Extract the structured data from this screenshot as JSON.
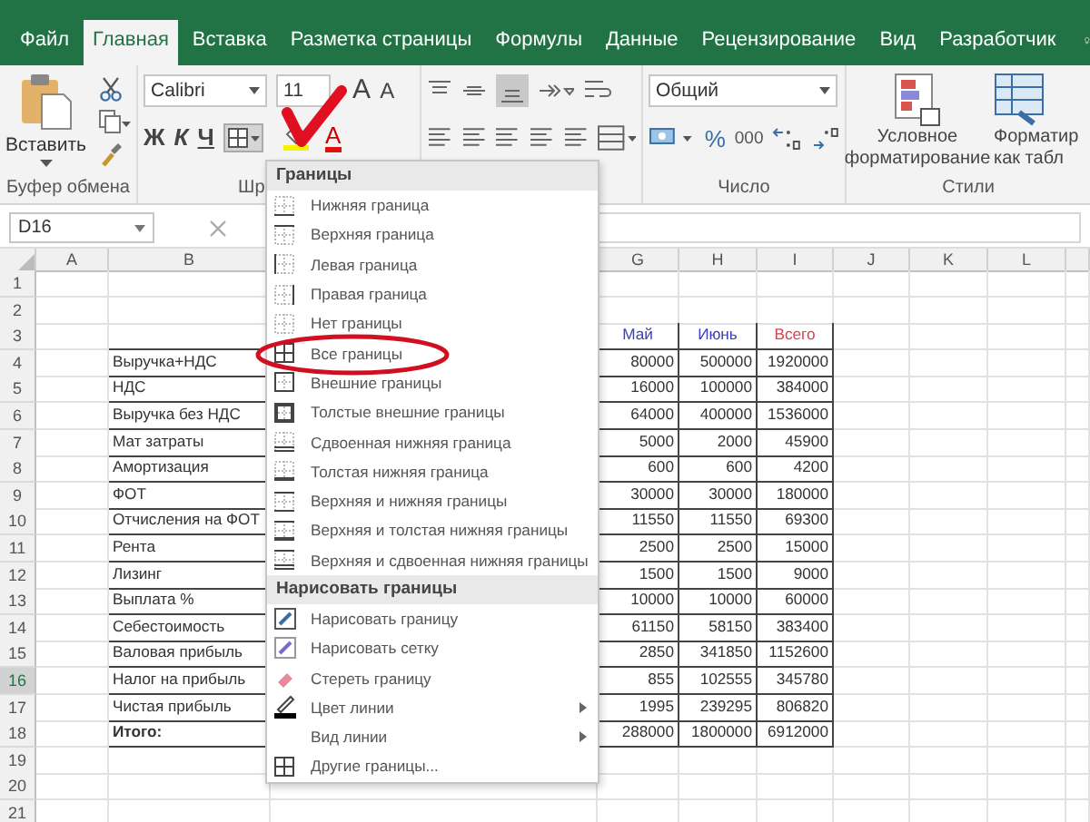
{
  "tabs": [
    {
      "label": "Файл",
      "selected": false
    },
    {
      "label": "Главная",
      "selected": true
    },
    {
      "label": "Вставка",
      "selected": false
    },
    {
      "label": "Разметка страницы",
      "selected": false
    },
    {
      "label": "Формулы",
      "selected": false
    },
    {
      "label": "Данные",
      "selected": false
    },
    {
      "label": "Рецензирование",
      "selected": false
    },
    {
      "label": "Вид",
      "selected": false
    },
    {
      "label": "Разработчик",
      "selected": false
    }
  ],
  "ribbon": {
    "clipboard": {
      "paste_label": "Вставить",
      "group_label": "Буфер обмена"
    },
    "font": {
      "font_name": "Calibri",
      "font_size": "11",
      "grow_key": "A",
      "shrink_key": "A",
      "bold_key": "Ж",
      "italic_key": "К",
      "underline_key": "Ч",
      "font_color_key": "A",
      "group_label": "Шр"
    },
    "number": {
      "format": "Общий",
      "percent": "%",
      "thousands": "000",
      "group_label": "Число"
    },
    "styles": {
      "conditional": "Условное форматирование",
      "format_table": [
        "Форматир",
        "как табл"
      ],
      "group_label": "Стили"
    }
  },
  "formula_bar": {
    "name_box": "D16"
  },
  "sheet": {
    "columns": [
      "A",
      "B",
      "G",
      "H",
      "I",
      "J",
      "K",
      "L"
    ],
    "rows": [
      {
        "num": "1",
        "selected": false
      },
      {
        "num": "2",
        "selected": false
      },
      {
        "num": "3",
        "selected": false,
        "headers": [
          {
            "text": "Май",
            "color": "#3b3bc4"
          },
          {
            "text": "Июнь",
            "color": "#3b3bc4"
          },
          {
            "text": "Всего",
            "color": "#e0404a"
          }
        ]
      },
      {
        "num": "4",
        "selected": false,
        "label": "Выручка+НДС",
        "values": [
          "80000",
          "500000",
          "1920000"
        ]
      },
      {
        "num": "5",
        "selected": false,
        "label": "НДС",
        "values": [
          "16000",
          "100000",
          "384000"
        ]
      },
      {
        "num": "6",
        "selected": false,
        "label": "Выручка без НДС",
        "values": [
          "64000",
          "400000",
          "1536000"
        ]
      },
      {
        "num": "7",
        "selected": false,
        "label": "Мат затраты",
        "values": [
          "5000",
          "2000",
          "45900"
        ]
      },
      {
        "num": "8",
        "selected": false,
        "label": "Амортизация",
        "values": [
          "600",
          "600",
          "4200"
        ]
      },
      {
        "num": "9",
        "selected": false,
        "label": "ФОТ",
        "values": [
          "30000",
          "30000",
          "180000"
        ]
      },
      {
        "num": "10",
        "selected": false,
        "label": "Отчисления на ФОТ",
        "values": [
          "11550",
          "11550",
          "69300"
        ]
      },
      {
        "num": "11",
        "selected": false,
        "label": "Рента",
        "values": [
          "2500",
          "2500",
          "15000"
        ]
      },
      {
        "num": "12",
        "selected": false,
        "label": "Лизинг",
        "values": [
          "1500",
          "1500",
          "9000"
        ]
      },
      {
        "num": "13",
        "selected": false,
        "label": "Выплата %",
        "values": [
          "10000",
          "10000",
          "60000"
        ]
      },
      {
        "num": "14",
        "selected": false,
        "label": "Себестоимость",
        "values": [
          "61150",
          "58150",
          "383400"
        ]
      },
      {
        "num": "15",
        "selected": false,
        "label": "Валовая прибыль",
        "values": [
          "2850",
          "341850",
          "1152600"
        ]
      },
      {
        "num": "16",
        "selected": true,
        "label": "Налог на прибыль",
        "values": [
          "855",
          "102555",
          "345780"
        ]
      },
      {
        "num": "17",
        "selected": false,
        "label": "Чистая прибыль",
        "values": [
          "1995",
          "239295",
          "806820"
        ]
      },
      {
        "num": "18",
        "selected": false,
        "kind": "total",
        "label": "Итого:",
        "values": [
          "288000",
          "1800000",
          "6912000"
        ]
      },
      {
        "num": "19",
        "selected": false
      },
      {
        "num": "20",
        "selected": false
      },
      {
        "num": "21",
        "selected": false
      }
    ]
  },
  "borders_menu": {
    "sections": [
      {
        "title": "Границы",
        "items": [
          {
            "label": "Нижняя граница",
            "kind": "border"
          },
          {
            "label": "Верхняя граница",
            "kind": "border"
          },
          {
            "label": "Левая граница",
            "kind": "border"
          },
          {
            "label": "Правая граница",
            "kind": "border"
          },
          {
            "label": "Нет границы",
            "kind": "border"
          },
          {
            "label": "Все границы",
            "kind": "border"
          },
          {
            "label": "Внешние границы",
            "kind": "border"
          },
          {
            "label": "Толстые внешние границы",
            "kind": "border"
          },
          {
            "label": "Сдвоенная нижняя граница",
            "kind": "border"
          },
          {
            "label": "Толстая нижняя граница",
            "kind": "border"
          },
          {
            "label": "Верхняя и нижняя границы",
            "kind": "border"
          },
          {
            "label": "Верхняя и толстая нижняя границы",
            "kind": "border"
          },
          {
            "label": "Верхняя и сдвоенная нижняя границы",
            "kind": "border"
          }
        ]
      },
      {
        "title": "Нарисовать границы",
        "items": [
          {
            "label": "Нарисовать границу",
            "kind": "tool"
          },
          {
            "label": "Нарисовать сетку",
            "kind": "tool"
          },
          {
            "label": "Стереть границу",
            "kind": "tool"
          },
          {
            "label": "Цвет линии",
            "kind": "submenu"
          },
          {
            "label": "Вид линии",
            "kind": "submenu"
          },
          {
            "label": "Другие границы...",
            "kind": "border"
          }
        ]
      }
    ]
  }
}
